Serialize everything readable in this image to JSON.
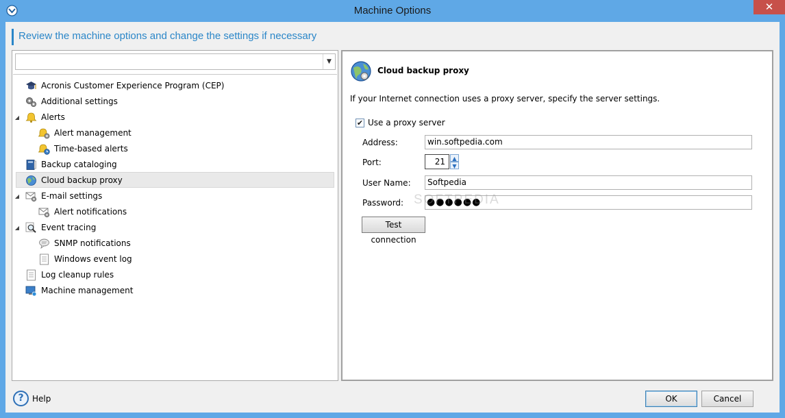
{
  "window": {
    "title": "Machine Options",
    "close_glyph": "✕"
  },
  "header": {
    "text": "Review the machine options and change the settings if necessary"
  },
  "filter": {
    "value": "",
    "arrow_glyph": "▼"
  },
  "tree": {
    "items": [
      {
        "label": "Acronis Customer Experience Program (CEP)",
        "icon": "graduation-cap-icon"
      },
      {
        "label": "Additional settings",
        "icon": "gears-icon"
      },
      {
        "label": "Alerts",
        "icon": "bell-icon",
        "expanded": true
      },
      {
        "label": "Alert management",
        "icon": "bell-gear-icon"
      },
      {
        "label": "Time-based alerts",
        "icon": "bell-clock-icon"
      },
      {
        "label": "Backup cataloging",
        "icon": "catalog-book-icon"
      },
      {
        "label": "Cloud backup proxy",
        "icon": "globe-icon",
        "selected": true
      },
      {
        "label": "E-mail settings",
        "icon": "email-gear-icon",
        "expanded": true
      },
      {
        "label": "Alert notifications",
        "icon": "email-alert-icon"
      },
      {
        "label": "Event tracing",
        "icon": "magnifier-icon",
        "expanded": true
      },
      {
        "label": "SNMP notifications",
        "icon": "speech-bubble-icon"
      },
      {
        "label": "Windows event log",
        "icon": "log-page-icon"
      },
      {
        "label": "Log cleanup rules",
        "icon": "list-page-icon"
      },
      {
        "label": "Machine management",
        "icon": "monitor-icon"
      }
    ],
    "expander_glyph": "◢"
  },
  "panel": {
    "title": "Cloud backup proxy",
    "description": "If your Internet connection uses a proxy server, specify the server settings.",
    "use_proxy_label": "Use a proxy server",
    "use_proxy_checked": true,
    "check_glyph": "✔",
    "address_label": "Address:",
    "address_value": "win.softpedia.com",
    "port_label": "Port:",
    "port_value": "21",
    "username_label": "User Name:",
    "username_value": "Softpedia",
    "password_label": "Password:",
    "password_value": "●●●●●●",
    "test_button": "Test connection",
    "spin_up_glyph": "▲",
    "spin_down_glyph": "▼"
  },
  "watermark": "SOFTPEDIA",
  "footer": {
    "help_label": "Help",
    "help_glyph": "?",
    "ok_label": "OK",
    "cancel_label": "Cancel"
  },
  "colors": {
    "title_bar": "#5fa8e6",
    "accent": "#2a86c8",
    "close_button": "#c7504a"
  }
}
